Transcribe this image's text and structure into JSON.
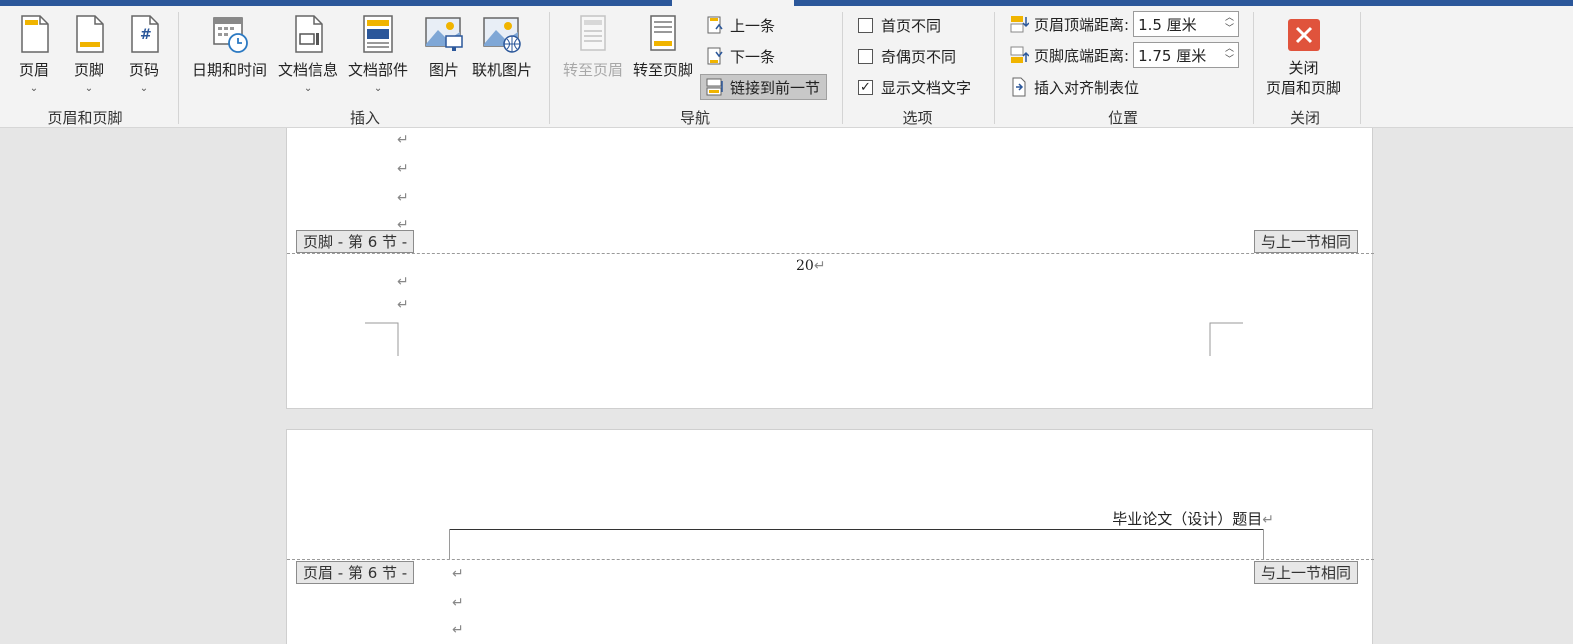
{
  "ribbon": {
    "groups": {
      "header_footer": {
        "label": "页眉和页脚",
        "header": "页眉",
        "footer": "页脚",
        "page_number": "页码"
      },
      "insert": {
        "label": "插入",
        "datetime": "日期和时间",
        "doc_info": "文档信息",
        "doc_parts": "文档部件",
        "picture": "图片",
        "online_picture": "联机图片"
      },
      "navigation": {
        "label": "导航",
        "goto_header": "转至页眉",
        "goto_footer": "转至页脚",
        "previous": "上一条",
        "next": "下一条",
        "link_previous": "链接到前一节"
      },
      "options": {
        "label": "选项",
        "different_first": "首页不同",
        "different_odd_even": "奇偶页不同",
        "show_doc_text": "显示文档文字"
      },
      "position": {
        "label": "位置",
        "header_top_label": "页眉顶端距离:",
        "header_top_value": "1.5 厘米",
        "footer_bottom_label": "页脚底端距离:",
        "footer_bottom_value": "1.75 厘米",
        "insert_align_tab": "插入对齐制表位"
      },
      "close": {
        "label": "关闭",
        "close_line1": "关闭",
        "close_line2": "页眉和页脚"
      }
    }
  },
  "document": {
    "page1": {
      "footer_tag": "页脚 - 第 6 节 -",
      "same_as_prev": "与上一节相同",
      "page_number": "20",
      "return_mark": "↵"
    },
    "page2": {
      "header_tag": "页眉 - 第 6 节 -",
      "same_as_prev": "与上一节相同",
      "header_text": "毕业论文（设计）题目",
      "return_mark": "↵"
    }
  },
  "colors": {
    "title_bar": "#2b579a",
    "ribbon_bg": "#f3f3f3",
    "close_red": "#e0533c",
    "canvas_bg": "#e6e6e6"
  }
}
